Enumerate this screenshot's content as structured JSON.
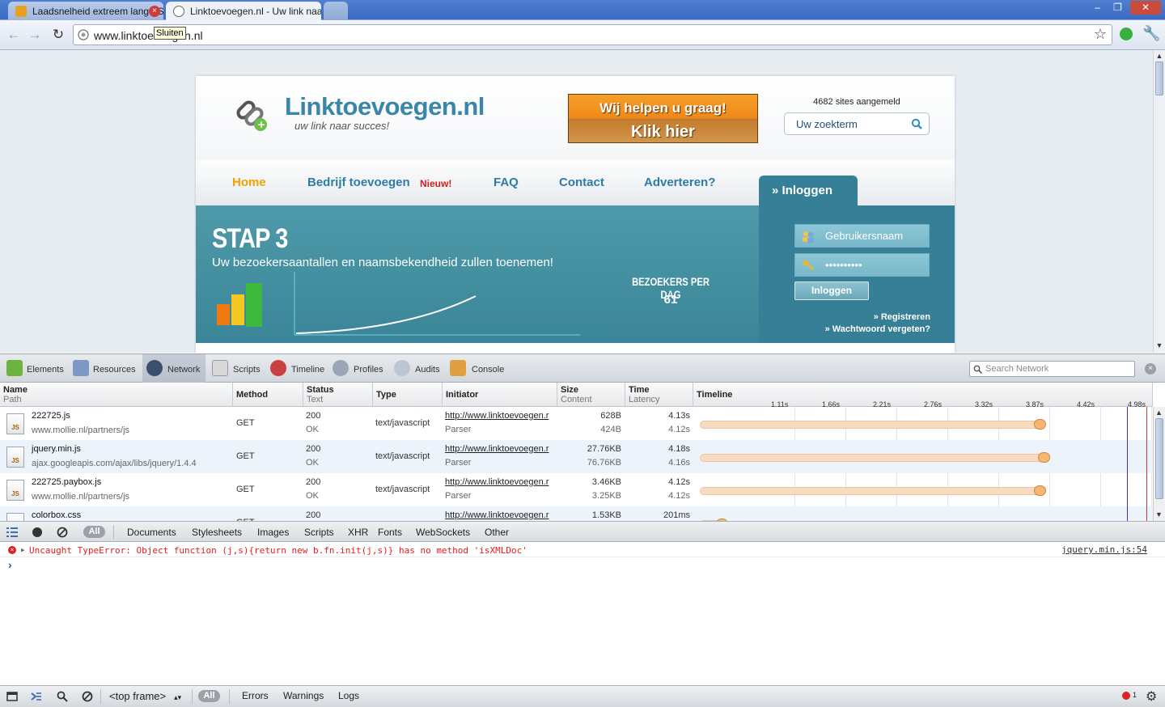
{
  "browser": {
    "tabs": [
      {
        "title": "Laadsnelheid extreem lang - S",
        "close_tooltip": "Sluiten"
      },
      {
        "title": "Linktoevoegen.nl - Uw link naa"
      }
    ],
    "address": "www.linktoevoegen.nl",
    "window_controls": [
      "–",
      "❐",
      "✕"
    ]
  },
  "site": {
    "brand": "Linktoevoegen.nl",
    "slogan": "uw link naar succes!",
    "banner_top": "Wij helpen u graag!",
    "banner_bottom": "Klik hier",
    "site_count": "4682 sites aangemeld",
    "search_placeholder": "Uw zoekterm",
    "nav": {
      "home": "Home",
      "add_company": "Bedrijf toevoegen",
      "new_badge": "Nieuw!",
      "faq": "FAQ",
      "contact": "Contact",
      "advertise": "Adverteren?"
    },
    "login_tab": "» Inloggen",
    "hero_title": "STAP 3",
    "hero_subtitle": "Uw bezoekersaantallen en naamsbekendheid zullen toenemen!",
    "visitors_label": "BEZOEKERS PER DAG",
    "visitors_count": "61",
    "login": {
      "username": "Gebruikersnaam",
      "password": "••••••••••",
      "button": "Inloggen",
      "register": "» Registreren",
      "forgot": "» Wachtwoord vergeten?"
    }
  },
  "devtools": {
    "tabs": [
      "Elements",
      "Resources",
      "Network",
      "Scripts",
      "Timeline",
      "Profiles",
      "Audits",
      "Console"
    ],
    "active_tab": "Network",
    "search_placeholder": "Search Network",
    "columns": {
      "name": "Name",
      "path": "Path",
      "method": "Method",
      "status": "Status",
      "status_text": "Text",
      "type": "Type",
      "initiator": "Initiator",
      "size": "Size",
      "content": "Content",
      "time": "Time",
      "latency": "Latency",
      "timeline": "Timeline"
    },
    "timeline_ticks": [
      "1.11s",
      "1.66s",
      "2.21s",
      "2.76s",
      "3.32s",
      "3.87s",
      "4.42s",
      "4.98s"
    ],
    "requests": [
      {
        "name": "222725.js",
        "path": "www.mollie.nl/partners/js",
        "method": "GET",
        "status": "200",
        "status_text": "OK",
        "type": "text/javascript",
        "initiator": "http://www.linktoevoegen.r",
        "initiator_kind": "Parser",
        "size": "628B",
        "content": "424B",
        "time": "4.13s",
        "latency": "4.12s",
        "start": 0.0,
        "end": 0.915
      },
      {
        "name": "jquery.min.js",
        "path": "ajax.googleapis.com/ajax/libs/jquery/1.4.4",
        "method": "GET",
        "status": "200",
        "status_text": "OK",
        "type": "text/javascript",
        "initiator": "http://www.linktoevoegen.r",
        "initiator_kind": "Parser",
        "size": "27.76KB",
        "content": "76.76KB",
        "time": "4.18s",
        "latency": "4.16s",
        "start": 0.0,
        "end": 0.925
      },
      {
        "name": "222725.paybox.js",
        "path": "www.mollie.nl/partners/js",
        "method": "GET",
        "status": "200",
        "status_text": "OK",
        "type": "text/javascript",
        "initiator": "http://www.linktoevoegen.r",
        "initiator_kind": "Parser",
        "size": "3.46KB",
        "content": "3.25KB",
        "time": "4.12s",
        "latency": "4.12s",
        "start": 0.0,
        "end": 0.915
      },
      {
        "name": "colorbox.css",
        "path": "",
        "method": "GET",
        "status": "200",
        "status_text": "",
        "type": "",
        "initiator": "http://www.linktoevoegen.r",
        "initiator_kind": "",
        "size": "1.53KB",
        "content": "",
        "time": "201ms",
        "latency": "",
        "start": 0.0,
        "end": 0.06
      }
    ],
    "filters": [
      "All",
      "Documents",
      "Stylesheets",
      "Images",
      "Scripts",
      "XHR",
      "Fonts",
      "WebSockets",
      "Other"
    ],
    "console_error": "Uncaught TypeError: Object function (j,s){return new b.fn.init(j,s)} has no method 'isXMLDoc'",
    "console_error_location": "jquery.min.js:54",
    "console_prompt": "›",
    "frame_select": "<top frame>",
    "console_filters": [
      "All",
      "Errors",
      "Warnings",
      "Logs"
    ],
    "error_count": "1"
  },
  "colors": {
    "site_teal": "#3a8597",
    "brand_blue": "#3a86a8",
    "error_red": "#e02020",
    "nav_home": "#f0a000"
  }
}
